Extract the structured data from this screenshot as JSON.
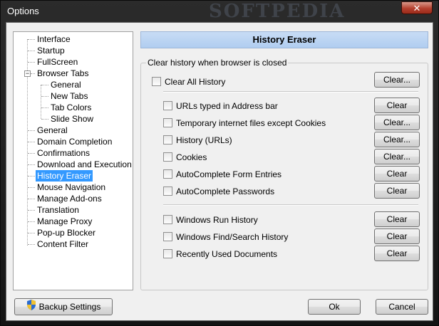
{
  "window": {
    "title": "Options",
    "watermark": "SOFTPEDIA",
    "close_glyph": "✕"
  },
  "tree": {
    "items": [
      {
        "label": "Interface"
      },
      {
        "label": "Startup"
      },
      {
        "label": "FullScreen"
      },
      {
        "label": "Browser Tabs",
        "expander": "−"
      },
      {
        "label": "General"
      },
      {
        "label": "New Tabs"
      },
      {
        "label": "Tab Colors"
      },
      {
        "label": "Slide Show"
      },
      {
        "label": "General"
      },
      {
        "label": "Domain Completion"
      },
      {
        "label": "Confirmations"
      },
      {
        "label": "Download and Execution"
      },
      {
        "label": "History Eraser",
        "selected": true
      },
      {
        "label": "Mouse Navigation"
      },
      {
        "label": "Manage Add-ons"
      },
      {
        "label": "Translation"
      },
      {
        "label": "Manage Proxy"
      },
      {
        "label": "Pop-up Blocker"
      },
      {
        "label": "Content Filter"
      }
    ]
  },
  "panel": {
    "header": "History Eraser",
    "group_label": "Clear history when browser is closed",
    "clear_all": {
      "label": "Clear All History",
      "button": "Clear..."
    },
    "items": [
      {
        "label": "URLs typed in Address bar",
        "button": "Clear"
      },
      {
        "label": "Temporary internet files except Cookies",
        "button": "Clear..."
      },
      {
        "label": "History (URLs)",
        "button": "Clear..."
      },
      {
        "label": "Cookies",
        "button": "Clear..."
      },
      {
        "label": "AutoComplete Form Entries",
        "button": "Clear"
      },
      {
        "label": "AutoComplete Passwords",
        "button": "Clear"
      }
    ],
    "windows_items": [
      {
        "label": "Windows Run History",
        "button": "Clear"
      },
      {
        "label": "Windows Find/Search History",
        "button": "Clear"
      },
      {
        "label": "Recently Used Documents",
        "button": "Clear"
      }
    ]
  },
  "footer": {
    "backup": "Backup Settings",
    "ok": "Ok",
    "cancel": "Cancel"
  }
}
